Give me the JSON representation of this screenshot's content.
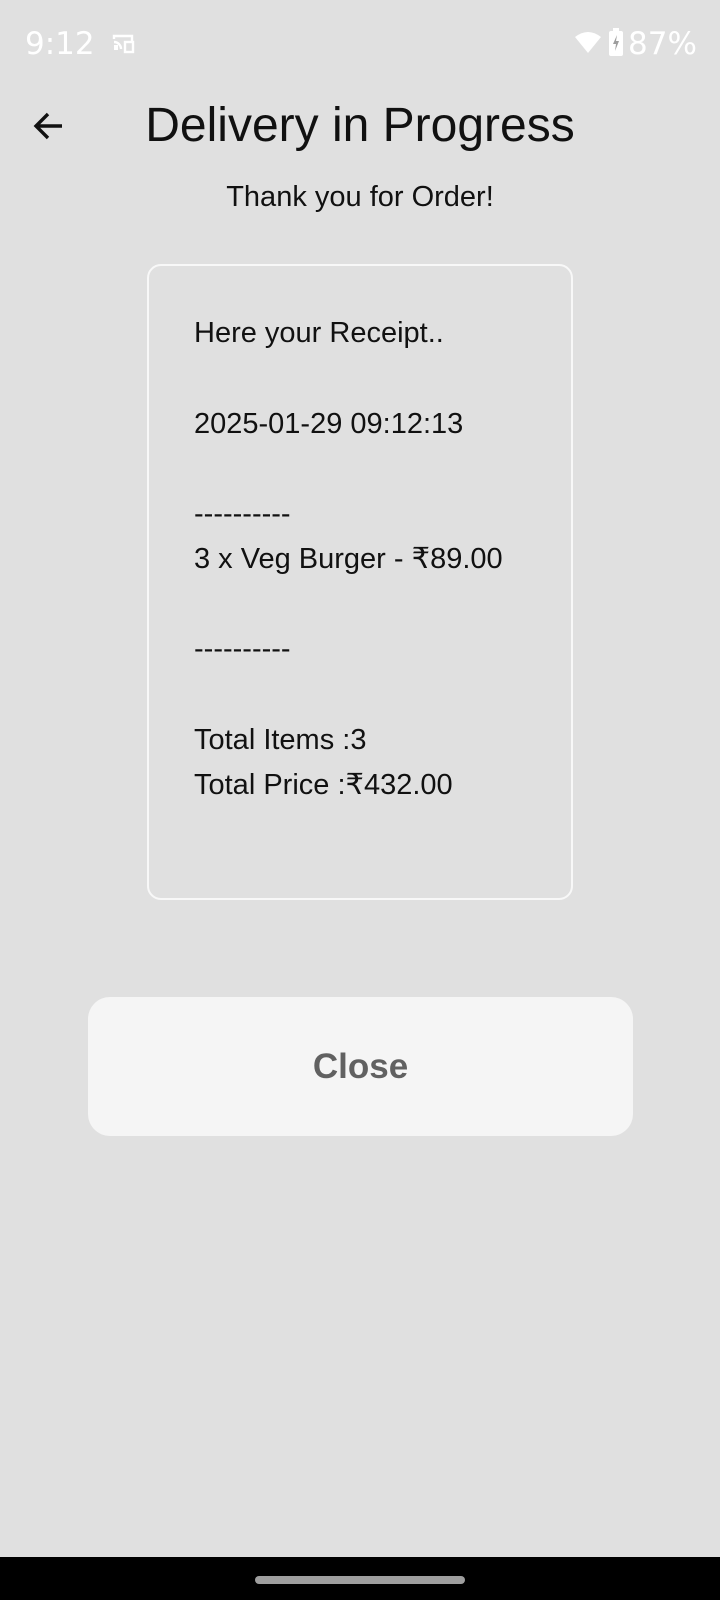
{
  "status_bar": {
    "time": "9:12",
    "battery_percent": "87%"
  },
  "header": {
    "title": "Delivery in Progress",
    "subtitle": "Thank you for Order!"
  },
  "receipt": {
    "heading": "Here your Receipt..",
    "timestamp": "2025-01-29 09:12:13",
    "separator_top": "----------",
    "item": "3 x Veg Burger - ₹89.00",
    "separator_bottom": "----------",
    "total_items": "Total Items :3",
    "total_price": "Total Price :₹432.00"
  },
  "actions": {
    "close_label": "Close"
  },
  "colors": {
    "background": "#e0e0e0",
    "button_bg": "#f5f5f5",
    "button_text": "#616161",
    "card_border": "#f8f8f8"
  }
}
